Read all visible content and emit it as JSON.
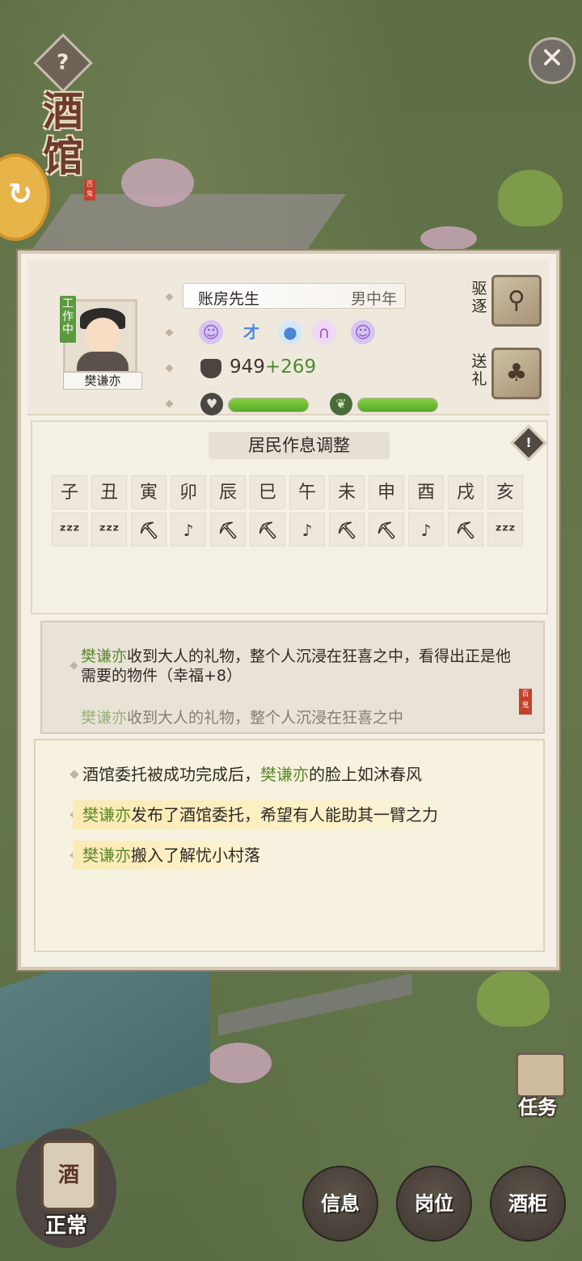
{
  "building": {
    "title": "酒馆",
    "seal": "百鬼"
  },
  "resident": {
    "status": "工作中",
    "name": "樊谦亦",
    "job": "账房先生",
    "demographic": "男中年",
    "trait_icons": [
      "purple-face-icon",
      "blue-talent-icon",
      "blue-bag-icon",
      "purple-hair-icon",
      "purple-face-icon"
    ],
    "trait_text": "才",
    "hp_base": "949",
    "hp_bonus": "+269",
    "mood_fill": 1.0,
    "health_fill": 1.0
  },
  "actions": {
    "evict": "驱逐",
    "gift": "送礼"
  },
  "schedule": {
    "title": "居民作息调整",
    "hours": [
      "子",
      "丑",
      "寅",
      "卯",
      "辰",
      "巳",
      "午",
      "未",
      "申",
      "酉",
      "戌",
      "亥"
    ],
    "activities": [
      "sleep",
      "sleep",
      "work",
      "social",
      "work",
      "work",
      "social",
      "work",
      "work",
      "social",
      "work",
      "sleep"
    ],
    "icons": {
      "sleep": "ᶻᶻᶻ",
      "work": "⛏",
      "social": "♪"
    }
  },
  "message": {
    "name": "樊谦亦",
    "text": "收到大人的礼物，整个人沉浸在狂喜之中，看得出正是他需要的物件（幸福+8）",
    "faded_name": "樊谦亦",
    "faded_text": "收到大人的礼物，整个人沉浸在狂喜之中"
  },
  "log": [
    {
      "pre": "酒馆委托被成功完成后，",
      "name": "樊谦亦",
      "post": "的脸上如沐春风"
    },
    {
      "pre": "",
      "name": "樊谦亦",
      "post": "发布了酒馆委托，希望有人能助其一臂之力"
    },
    {
      "pre": "",
      "name": "樊谦亦",
      "post": "搬入了解忧小村落"
    }
  ],
  "bottom": {
    "task": "任务",
    "jar_char": "酒",
    "status": "正常",
    "info": "信息",
    "post": "岗位",
    "cabinet": "酒柜"
  }
}
